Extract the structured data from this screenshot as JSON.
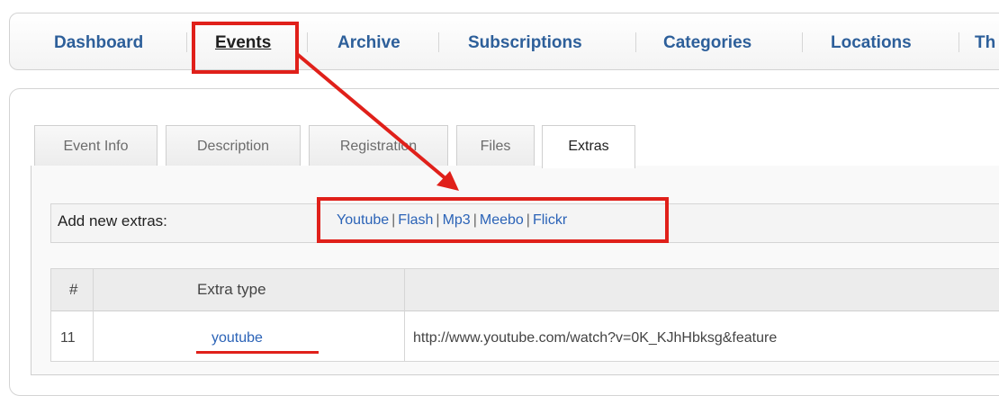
{
  "nav": {
    "items": [
      {
        "label": "Dashboard"
      },
      {
        "label": "Events"
      },
      {
        "label": "Archive"
      },
      {
        "label": "Subscriptions"
      },
      {
        "label": "Categories"
      },
      {
        "label": "Locations"
      },
      {
        "label": "Th"
      }
    ],
    "active": "Events"
  },
  "tabs": [
    {
      "label": "Event Info"
    },
    {
      "label": "Description"
    },
    {
      "label": "Registration"
    },
    {
      "label": "Files"
    },
    {
      "label": "Extras"
    }
  ],
  "active_tab": "Extras",
  "extras": {
    "add_label": "Add new extras:",
    "links": [
      "Youtube",
      "Flash",
      "Mp3",
      "Meebo",
      "Flickr"
    ],
    "separator": "|"
  },
  "table": {
    "headers": [
      "#",
      "Extra type",
      ""
    ],
    "rows": [
      {
        "id": "11",
        "type": "youtube",
        "url": "http://www.youtube.com/watch?v=0K_KJhHbksg&feature"
      }
    ]
  },
  "colors": {
    "accent_link": "#2b63b7",
    "annotation": "#e0201a"
  }
}
